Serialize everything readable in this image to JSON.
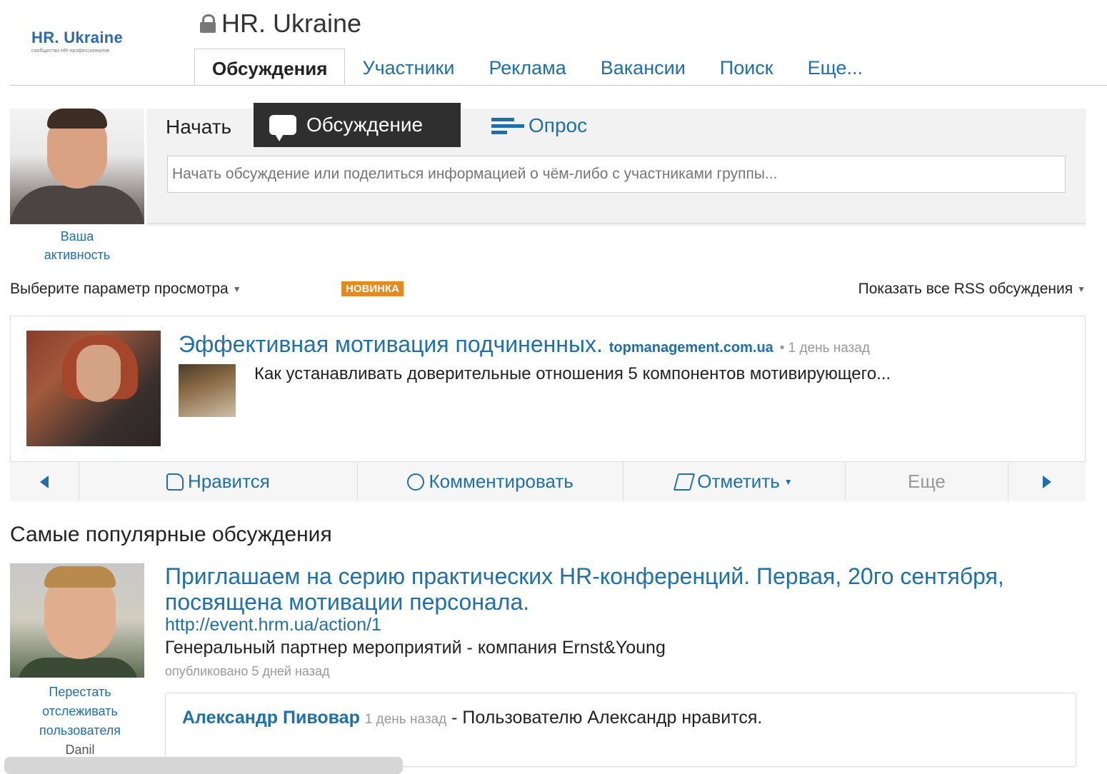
{
  "group": {
    "logo_name": "HR. Ukraine",
    "logo_tagline": "сообщество HR-профессионалов",
    "title": "HR. Ukraine"
  },
  "tabs": [
    {
      "label": "Обсуждения",
      "active": true
    },
    {
      "label": "Участники"
    },
    {
      "label": "Реклама"
    },
    {
      "label": "Вакансии"
    },
    {
      "label": "Поиск"
    },
    {
      "label": "Еще..."
    }
  ],
  "composer": {
    "start_label": "Начать",
    "discussion_button": "Обсуждение",
    "poll_button": "Опрос",
    "placeholder": "Начать обсуждение или поделиться информацией о чём-либо с участниками группы...",
    "activity_label_1": "Ваша",
    "activity_label_2": "активность"
  },
  "view": {
    "param_label": "Выберите параметр просмотра",
    "new_badge": "НОВИНКА",
    "rss_label": "Показать все RSS обсуждения"
  },
  "featured": {
    "title": "Эффективная мотивация подчиненных.",
    "source": "topmanagement.com.ua",
    "time": "• 1 день назад",
    "snippet": "Как устанавливать доверительные отношения 5 компонентов мотивирующего..."
  },
  "actions": {
    "like": "Нравится",
    "comment": "Комментировать",
    "flag": "Отметить",
    "more": "Еще"
  },
  "popular": {
    "heading": "Самые популярные обсуждения",
    "title": "Приглашаем на серию практических HR-конференций. Первая, 20го сентября, посвящена мотивации персонала.",
    "url": "http://event.hrm.ua/action/1",
    "body": "Генеральный партнер мероприятий - компания Ernst&Young",
    "meta": "опубликовано 5 дней назад",
    "unfollow_1": "Перестать",
    "unfollow_2": "отслеживать",
    "unfollow_3": "пользователя",
    "unfollow_user": "Danil",
    "like_user": "Александр Пивовар",
    "like_time": "1 день назад",
    "like_text": "- Пользователю Александр нравится."
  },
  "colors": {
    "link": "#1f6fa8",
    "badge": "#e48a1e",
    "dark_button": "#2f2f2f"
  }
}
